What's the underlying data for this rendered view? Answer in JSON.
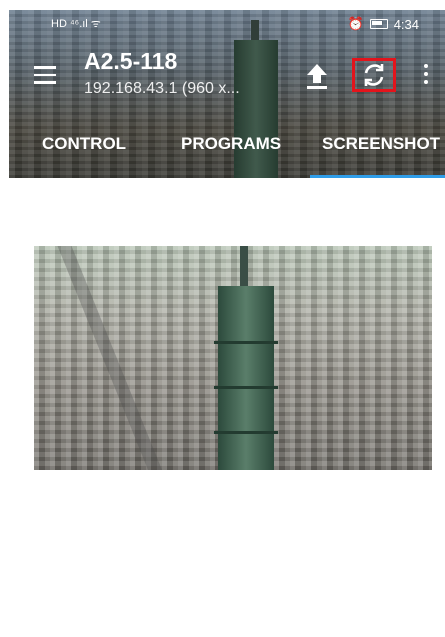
{
  "status_bar": {
    "left_text": "HD ⁴⁶.ıl ᯤ",
    "alarm_icon": "alarm-icon",
    "battery_icon": "battery-icon",
    "time": "4:34"
  },
  "toolbar": {
    "menu_icon": "menu-icon",
    "title": "A2.5-118",
    "subtitle": "192.168.43.1 (960 x...",
    "upload_icon": "upload-icon",
    "refresh_icon": "refresh-icon",
    "more_icon": "more-vertical-icon",
    "highlight_color": "#e3141c"
  },
  "tabs": [
    {
      "label": "CONTROL"
    },
    {
      "label": "PROGRAMS"
    },
    {
      "label": "SCREENSHOT",
      "active": true
    }
  ],
  "accent_color": "#2f9de8",
  "screenshot_image": {
    "icon": "city-skyline-image"
  }
}
